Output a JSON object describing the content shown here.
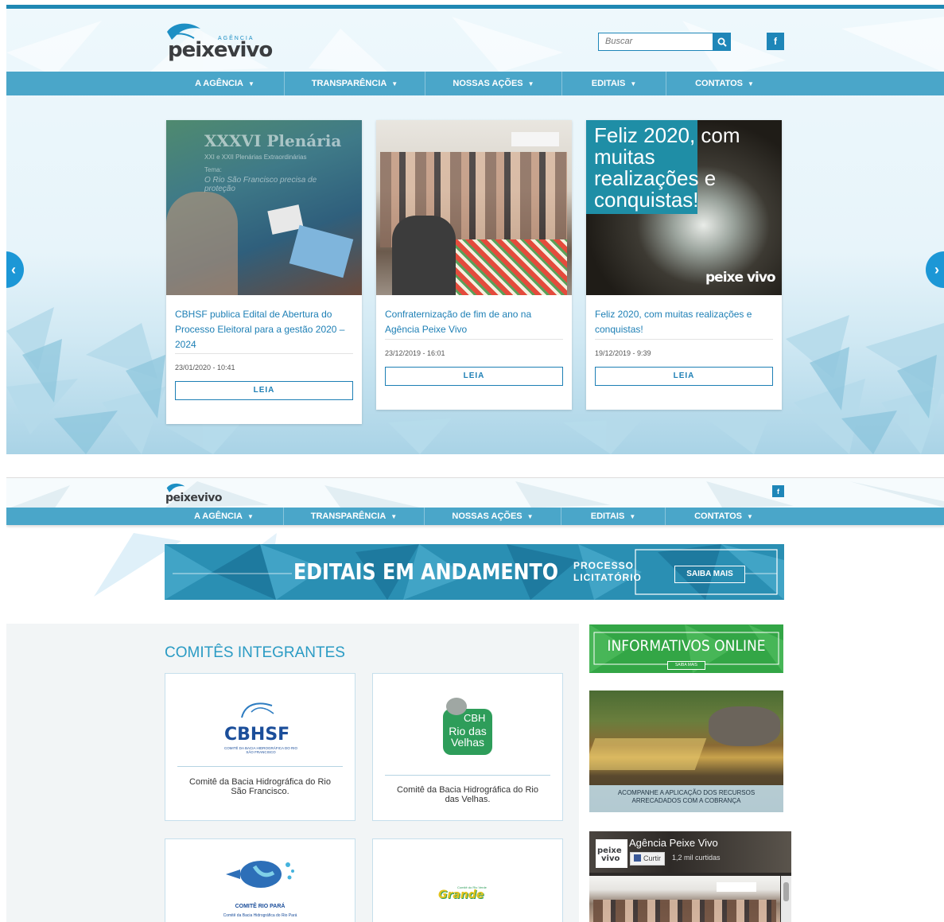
{
  "header": {
    "logo_small": "AGÊNCIA",
    "logo_word_a": "peixe",
    "logo_word_b": "vivo",
    "search_placeholder": "Buscar",
    "search_icon": "search-icon",
    "facebook_label": "f"
  },
  "nav": {
    "items": [
      {
        "label": "A AGÊNCIA"
      },
      {
        "label": "TRANSPARÊNCIA"
      },
      {
        "label": "NOSSAS AÇÕES"
      },
      {
        "label": "EDITAIS"
      },
      {
        "label": "CONTATOS"
      }
    ],
    "caret": "▼"
  },
  "carousel": {
    "prev": "‹",
    "next": "›",
    "cards": [
      {
        "image_text_1": "XXXVI Plenária",
        "image_text_2": "XXI e XXII Plenárias Extraordinárias",
        "image_text_3": "Tema:",
        "image_text_4": "O Rio São Francisco precisa de proteção",
        "title": "CBHSF publica Edital de Abertura do Processo Eleitoral para a gestão 2020 – 2024",
        "date": "23/01/2020 - 10:41",
        "button": "LEIA"
      },
      {
        "title": "Confraternização de fim de ano na Agência Peixe Vivo",
        "date": "23/12/2019 - 16:01",
        "button": "LEIA"
      },
      {
        "image_text": "Feliz 2020, com muitas realizações e conquistas!",
        "image_logo": "peixe vivo",
        "title": "Feliz 2020, com muitas realizações e conquistas!",
        "date": "19/12/2019 - 9:39",
        "button": "LEIA"
      }
    ]
  },
  "banner": {
    "title": "EDITAIS EM ANDAMENTO",
    "subtitle_1": "PROCESSO",
    "subtitle_2": "LICITATÓRIO",
    "button": "SAIBA MAIS"
  },
  "comites": {
    "heading": "COMITÊS INTEGRANTES",
    "items": [
      {
        "logo": "CBHSF",
        "logo_sub": "COMITÊ DA BACIA HIDROGRÁFICA DO RIO SÃO FRANCISCO",
        "caption": "Comitê da Bacia Hidrográfica do Rio São Francisco."
      },
      {
        "logo_1": "CBH",
        "logo_2": "Rio das",
        "logo_3": "Velhas",
        "caption": "Comitê da Bacia Hidrográfica do Rio das Velhas."
      },
      {
        "logo": "COMITÊ RIO PARÁ",
        "logo_sub": "Comitê da Bacia Hidrográfica do Rio Pará",
        "caption": ""
      },
      {
        "logo_small": "Comitê do Rio Verde",
        "logo": "Grande",
        "caption": ""
      }
    ]
  },
  "sidebar": {
    "informativos_title": "INFORMATIVOS ONLINE",
    "informativos_button": "SAIBA MAIS",
    "recursos_caption_1": "ACOMPANHE A APLICAÇÃO DOS RECURSOS",
    "recursos_caption_2": "ARRECADADOS COM A COBRANÇA",
    "fb_page_name": "Agência Peixe Vivo",
    "fb_like": "Curtir",
    "fb_likes": "1,2 mil curtidas",
    "fb_logo_1": "peixe",
    "fb_logo_2": "vivo"
  }
}
